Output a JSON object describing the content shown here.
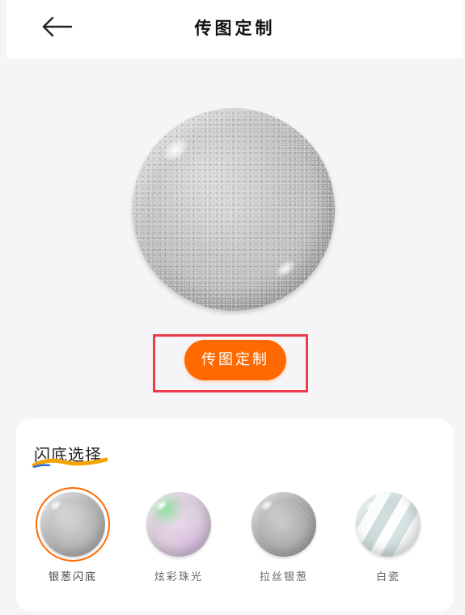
{
  "header": {
    "title": "传图定制"
  },
  "main": {
    "upload_button_label": "传图定制"
  },
  "panel": {
    "title": "闪底选择",
    "options": [
      {
        "label": "银葱闪底",
        "selected": true
      },
      {
        "label": "炫彩珠光",
        "selected": false
      },
      {
        "label": "拉丝银葱",
        "selected": false
      },
      {
        "label": "白瓷",
        "selected": false
      }
    ]
  },
  "colors": {
    "accent": "#ff6a00",
    "highlight_border": "#ec3b4a",
    "title_underline": "#f5a300",
    "title_underline_blue": "#2b6cf0"
  }
}
